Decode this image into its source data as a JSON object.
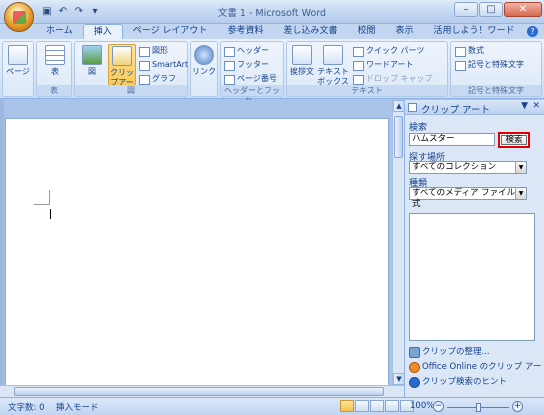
{
  "titlebar": {
    "title": "文書 1 - Microsoft Word",
    "minimize": "–",
    "maximize": "□",
    "close": "✕"
  },
  "qat": {
    "save_icon": "save-icon",
    "undo_icon": "undo-icon",
    "redo_icon": "redo-icon"
  },
  "tabs": [
    "ホーム",
    "挿入",
    "ページ レイアウト",
    "参考資料",
    "差し込み文書",
    "校閲",
    "表示",
    "活用しよう！ワード"
  ],
  "ribbon": {
    "page_btn": "ページ",
    "table_btn": "表",
    "table_group": "表",
    "picture_btn": "図",
    "clipart_btn": "クリップアート",
    "shapes_btn": "図形",
    "smartart_btn": "SmartArt",
    "chart_btn": "グラフ",
    "illust_group": "図",
    "link_btn": "リンク",
    "header_btn": "ヘッダー",
    "footer_btn": "フッター",
    "pagenum_btn": "ページ番号",
    "hf_group": "ヘッダーとフッター",
    "greeting_btn": "挨拶文",
    "textbox_btn": "テキストボックス",
    "quickparts_btn": "クイック パーツ",
    "wordart_btn": "ワードアート",
    "dropcap_btn": "ドロップ キャップ",
    "text_group": "テキスト",
    "equation_btn": "数式",
    "symbol_btn": "記号と特殊文字",
    "symbol_group": "記号と特殊文字"
  },
  "pane": {
    "title": "クリップ アート",
    "search_label": "検索",
    "search_value": "ハムスター",
    "go_label": "検索",
    "location_label": "探す場所",
    "location_value": "すべてのコレクション",
    "type_label": "種類",
    "type_value": "すべてのメディア ファイル形式",
    "link_organize": "クリップの整理...",
    "link_online": "Office Online のクリップ アート",
    "link_hints": "クリップ検索のヒント"
  },
  "status": {
    "word_count": "文字数: 0",
    "insert_mode": "挿入モード",
    "zoom": "100%"
  }
}
